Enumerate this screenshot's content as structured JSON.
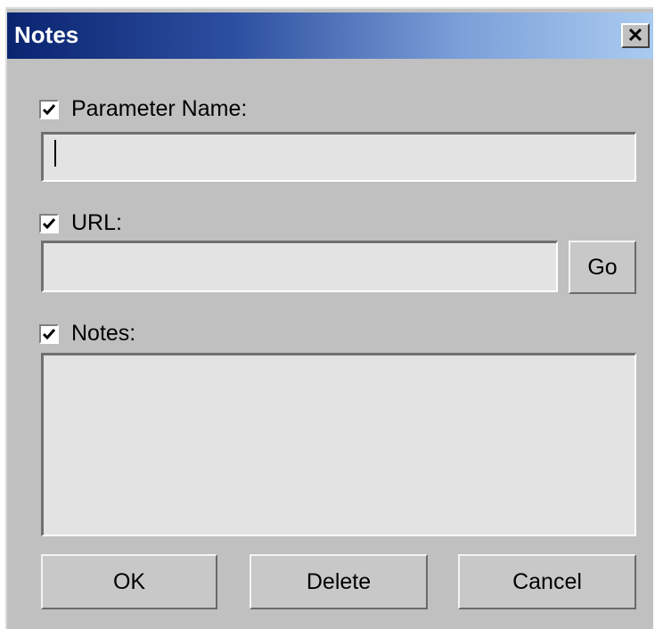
{
  "window": {
    "title": "Notes",
    "close_glyph": "✕"
  },
  "parameter_name": {
    "label": "Parameter Name:",
    "checked": true,
    "value": ""
  },
  "url": {
    "label": "URL:",
    "checked": true,
    "value": "",
    "go_label": "Go"
  },
  "notes": {
    "label": "Notes:",
    "checked": true,
    "value": ""
  },
  "buttons": {
    "ok": "OK",
    "delete": "Delete",
    "cancel": "Cancel"
  }
}
